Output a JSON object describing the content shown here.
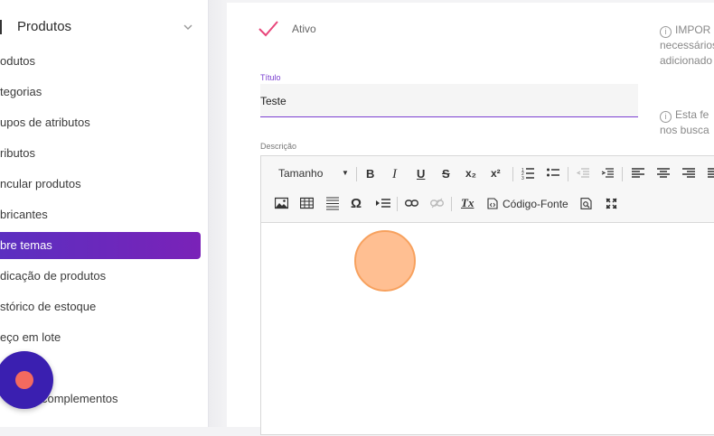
{
  "sidebar": {
    "section_title": "Produtos",
    "items": [
      {
        "label": "odutos"
      },
      {
        "label": "tegorias"
      },
      {
        "label": "upos de atributos"
      },
      {
        "label": "ributos"
      },
      {
        "label": "ncular produtos"
      },
      {
        "label": "bricantes"
      },
      {
        "label": "bre temas",
        "active": true
      },
      {
        "label": "dicação de produtos"
      },
      {
        "label": "stórico de estoque"
      },
      {
        "label": "eço em lote"
      },
      {
        "label": "complementos"
      }
    ]
  },
  "form": {
    "active_label": "Ativo",
    "title_label": "Título",
    "title_value": "Teste",
    "description_label": "Descrição",
    "note1_line1": "IMPOR",
    "note1_line2": "necessários",
    "note1_line3": "adicionado",
    "note2_line1": "Esta fe",
    "note2_line2": "nos busca"
  },
  "editor": {
    "font_size_select": "Tamanho",
    "source_code_label": "Código-Fonte",
    "caret": "▼",
    "buttons": {
      "bold": "B",
      "italic": "I",
      "underline": "U",
      "strike": "S",
      "subscript": "x₂",
      "superscript": "x²",
      "special_char": "Ω",
      "clear_format": "Tx"
    }
  },
  "colors": {
    "accent": "#7a3fd0",
    "active_gradient_start": "#5b2fc0",
    "active_gradient_end": "#7a22b8",
    "check": "#e8457a",
    "fab": "#3a1fb0",
    "fab_dot": "#f36a5f"
  }
}
